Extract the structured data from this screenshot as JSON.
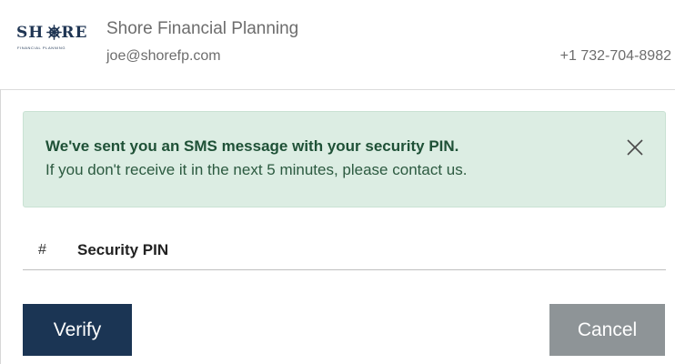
{
  "header": {
    "logo": {
      "text": "SHORE",
      "subtext": "FINANCIAL PLANNING"
    },
    "company_name": "Shore Financial Planning",
    "email": "joe@shorefp.com",
    "phone": "+1 732-704-8982"
  },
  "alert": {
    "title": "We've sent you an SMS message with your security PIN.",
    "body": "If you don't receive it in the next 5 minutes, please contact us.",
    "close_icon": "close-icon"
  },
  "pin_field": {
    "icon": "#",
    "placeholder": "Security PIN",
    "value": ""
  },
  "buttons": {
    "verify_label": "Verify",
    "cancel_label": "Cancel"
  },
  "colors": {
    "brand_navy": "#1b3554",
    "alert_bg": "#dcede3",
    "alert_text": "#1f5137",
    "cancel_gray": "#8e9497",
    "header_text": "#6d6d6d"
  }
}
